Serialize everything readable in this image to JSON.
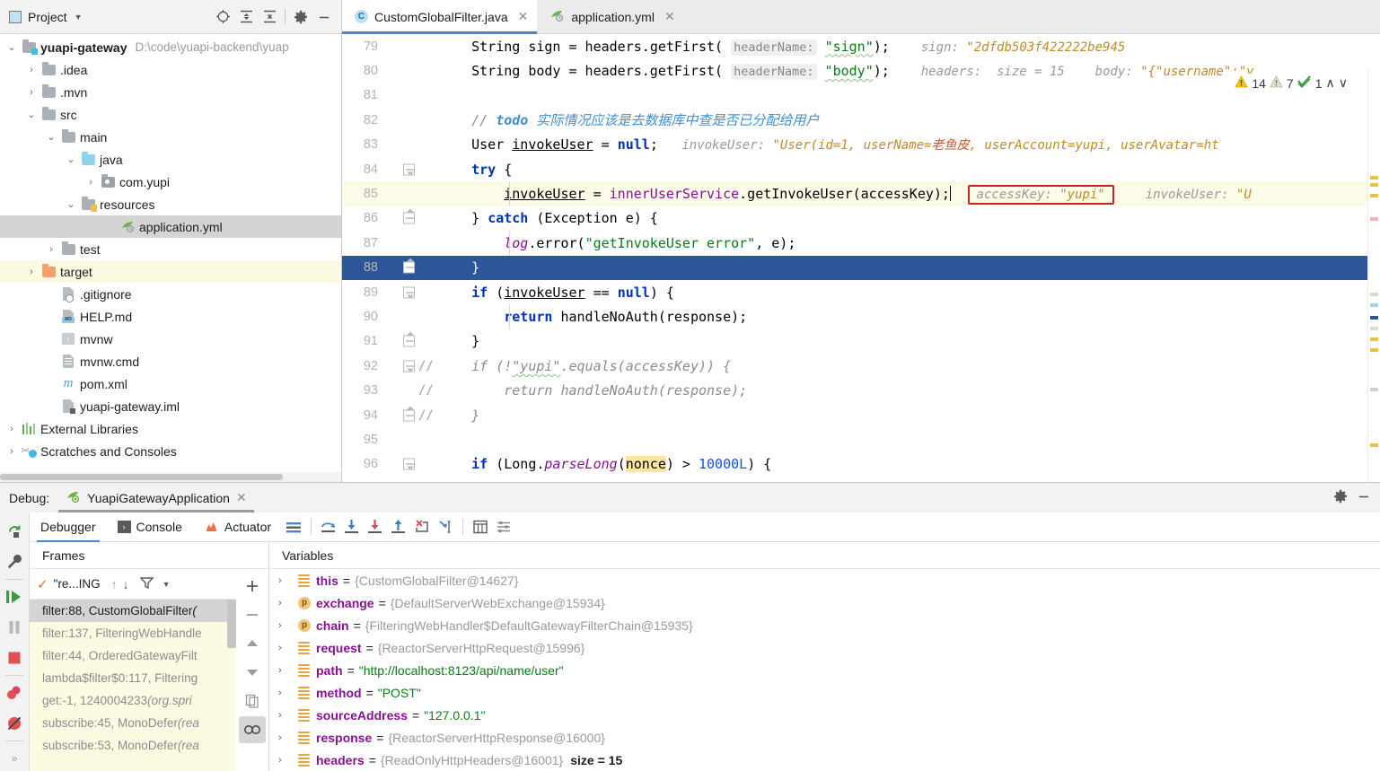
{
  "project": {
    "title": "Project",
    "header_icons": [
      "locate-icon",
      "expand-all-icon",
      "collapse-all-icon",
      "gear-icon",
      "minimize-icon"
    ],
    "tree": [
      {
        "label": "yuapi-gateway",
        "path": "D:\\code\\yuapi-backend\\yuap",
        "depth": 0,
        "twisty": "down",
        "icon": "module-folder-icon",
        "bold": true
      },
      {
        "label": ".idea",
        "path": "",
        "depth": 1,
        "twisty": "right",
        "icon": "folder-icon",
        "bold": false
      },
      {
        "label": ".mvn",
        "path": "",
        "depth": 1,
        "twisty": "right",
        "icon": "folder-icon",
        "bold": false
      },
      {
        "label": "src",
        "path": "",
        "depth": 1,
        "twisty": "down",
        "icon": "folder-icon",
        "bold": false
      },
      {
        "label": "main",
        "path": "",
        "depth": 2,
        "twisty": "down",
        "icon": "folder-icon",
        "bold": false
      },
      {
        "label": "java",
        "path": "",
        "depth": 3,
        "twisty": "down",
        "icon": "source-folder-icon",
        "bold": false
      },
      {
        "label": "com.yupi",
        "path": "",
        "depth": 4,
        "twisty": "right",
        "icon": "package-icon",
        "bold": false
      },
      {
        "label": "resources",
        "path": "",
        "depth": 3,
        "twisty": "down",
        "icon": "resources-folder-icon",
        "bold": false
      },
      {
        "label": "application.yml",
        "path": "",
        "depth": 5,
        "twisty": "none",
        "icon": "spring-yaml-icon",
        "bold": false,
        "selected": true
      },
      {
        "label": "test",
        "path": "",
        "depth": 2,
        "twisty": "right",
        "icon": "folder-icon",
        "bold": false
      },
      {
        "label": "target",
        "path": "",
        "depth": 1,
        "twisty": "right",
        "icon": "target-folder-icon",
        "bold": false,
        "highlight": true
      },
      {
        "label": ".gitignore",
        "path": "",
        "depth": 2,
        "twisty": "none",
        "icon": "gitignore-icon",
        "bold": false
      },
      {
        "label": "HELP.md",
        "path": "",
        "depth": 2,
        "twisty": "none",
        "icon": "markdown-icon",
        "bold": false
      },
      {
        "label": "mvnw",
        "path": "",
        "depth": 2,
        "twisty": "none",
        "icon": "script-icon",
        "bold": false
      },
      {
        "label": "mvnw.cmd",
        "path": "",
        "depth": 2,
        "twisty": "none",
        "icon": "text-file-icon",
        "bold": false
      },
      {
        "label": "pom.xml",
        "path": "",
        "depth": 2,
        "twisty": "none",
        "icon": "maven-icon",
        "bold": false
      },
      {
        "label": "yuapi-gateway.iml",
        "path": "",
        "depth": 2,
        "twisty": "none",
        "icon": "iml-icon",
        "bold": false
      },
      {
        "label": "External Libraries",
        "path": "",
        "depth": 0,
        "twisty": "right",
        "icon": "libraries-icon",
        "bold": false
      },
      {
        "label": "Scratches and Consoles",
        "path": "",
        "depth": 0,
        "twisty": "right",
        "icon": "scratches-icon",
        "bold": false
      }
    ]
  },
  "editor": {
    "tabs": [
      {
        "label": "CustomGlobalFilter.java",
        "icon": "java-class-icon",
        "active": true
      },
      {
        "label": "application.yml",
        "icon": "spring-yaml-icon",
        "active": false
      }
    ],
    "inspections": {
      "error_count": "14",
      "warning_count": "7",
      "ok_count": "1",
      "up_arrow": "∧",
      "down_arrow": "∨"
    },
    "lines": [
      {
        "num": "79",
        "text": "    String sign = headers.getFirst( headerName: \"sign\");   sign: \"2dfdb503f422222be945",
        "fold": "none"
      },
      {
        "num": "80",
        "text": "    String body = headers.getFirst( headerName: \"body\");   headers:  size = 15    body: \"{\"username\":\"y",
        "fold": "none"
      },
      {
        "num": "81",
        "text": "",
        "fold": "none"
      },
      {
        "num": "82",
        "text": "    // todo 实际情况应该是去数据库中查是否已分配给用户",
        "fold": "none"
      },
      {
        "num": "83",
        "text": "    User invokeUser = null;   invokeUser: \"User(id=1, userName=老鱼皮, userAccount=yupi, userAvatar=ht",
        "fold": "none"
      },
      {
        "num": "84",
        "text": "    try {",
        "fold": "down"
      },
      {
        "num": "85",
        "text": "        invokeUser = innerUserService.getInvokeUser(accessKey);   accessKey: \"yupi\"    invokeUser: \"U",
        "fold": "none"
      },
      {
        "num": "86",
        "text": "    } catch (Exception e) {",
        "fold": "up"
      },
      {
        "num": "87",
        "text": "        log.error(\"getInvokeUser error\", e);",
        "fold": "none"
      },
      {
        "num": "88",
        "text": "    }",
        "fold": "up"
      },
      {
        "num": "89",
        "text": "    if (invokeUser == null) {",
        "fold": "down"
      },
      {
        "num": "90",
        "text": "        return handleNoAuth(response);",
        "fold": "none"
      },
      {
        "num": "91",
        "text": "    }",
        "fold": "up"
      },
      {
        "num": "92",
        "text": "//    if (!\"yupi\".equals(accessKey)) {",
        "fold": "down"
      },
      {
        "num": "93",
        "text": "//        return handleNoAuth(response);",
        "fold": "none"
      },
      {
        "num": "94",
        "text": "//    }",
        "fold": "up"
      },
      {
        "num": "95",
        "text": "",
        "fold": "none"
      },
      {
        "num": "96",
        "text": "    if (Long.parseLong(nonce) > 10000L) {",
        "fold": "down"
      }
    ]
  },
  "debug": {
    "label": "Debug:",
    "config_name": "YuapiGatewayApplication",
    "tabs": [
      {
        "label": "Debugger",
        "icon": "debugger-icon",
        "active": true
      },
      {
        "label": "Console",
        "icon": "console-icon",
        "active": false
      },
      {
        "label": "Actuator",
        "icon": "actuator-icon",
        "active": false
      }
    ],
    "toolbar_icons": [
      "layout-icon",
      "step-over-icon",
      "step-into-icon",
      "force-step-into-icon",
      "step-out-icon",
      "run-to-cursor-icon",
      "drop-frame-icon",
      "evaluate-icon",
      "settings-list-icon"
    ],
    "rail_icons": [
      "rerun-icon",
      "wrench-icon",
      "resume-icon",
      "pause-icon",
      "stop-icon",
      "view-breakpoints-icon",
      "mute-breakpoints-icon"
    ],
    "right_icons": [
      "gear-icon",
      "minimize-icon",
      "layout-icon"
    ],
    "frames": {
      "header": "Frames",
      "thread_label": "\"re...ING",
      "toolbar_icons": [
        "check-icon",
        "up-icon",
        "down-icon",
        "filter-icon",
        "chevron-down-icon"
      ],
      "side_icons": [
        "add-icon",
        "remove-icon",
        "up-icon",
        "down-icon",
        "copy-icon",
        "watches-icon"
      ],
      "items": [
        {
          "label": "filter:88, CustomGlobalFilter ",
          "suffix": "(",
          "selected": true
        },
        {
          "label": "filter:137, FilteringWebHandle",
          "suffix": "",
          "selected": false
        },
        {
          "label": "filter:44, OrderedGatewayFilt",
          "suffix": "",
          "selected": false
        },
        {
          "label": "lambda$filter$0:117, Filtering",
          "suffix": "",
          "selected": false
        },
        {
          "label": "get:-1, 1240004233 ",
          "suffix": "(org.spri",
          "selected": false
        },
        {
          "label": "subscribe:45, MonoDefer ",
          "suffix": "(rea",
          "selected": false
        },
        {
          "label": "subscribe:53, MonoDefer ",
          "suffix": "(rea",
          "selected": false
        }
      ]
    },
    "variables": {
      "header": "Variables",
      "items": [
        {
          "name": "this",
          "value": "{CustomGlobalFilter@14627}",
          "kind": "obj",
          "icon": "field-stack-icon"
        },
        {
          "name": "exchange",
          "value": "{DefaultServerWebExchange@15934}",
          "kind": "obj",
          "icon": "parameter-icon"
        },
        {
          "name": "chain",
          "value": "{FilteringWebHandler$DefaultGatewayFilterChain@15935}",
          "kind": "obj",
          "icon": "parameter-icon"
        },
        {
          "name": "request",
          "value": "{ReactorServerHttpRequest@15996}",
          "kind": "obj",
          "icon": "field-stack-icon"
        },
        {
          "name": "path",
          "value": "\"http://localhost:8123/api/name/user\"",
          "kind": "str",
          "icon": "field-stack-icon"
        },
        {
          "name": "method",
          "value": "\"POST\"",
          "kind": "str",
          "icon": "field-stack-icon"
        },
        {
          "name": "sourceAddress",
          "value": "\"127.0.0.1\"",
          "kind": "str",
          "icon": "field-stack-icon"
        },
        {
          "name": "response",
          "value": "{ReactorServerHttpResponse@16000}",
          "kind": "obj",
          "icon": "field-stack-icon"
        },
        {
          "name": "headers",
          "value": "{ReadOnlyHttpHeaders@16001}",
          "kind": "obj",
          "icon": "field-stack-icon",
          "extra": "size = 15"
        }
      ]
    }
  },
  "colors": {
    "accent": "#4a86c8",
    "exec_line": "#2c5699",
    "soft_hl": "#fcfbe8",
    "selection": "#d4d4d4",
    "frames_bg": "#fbfbe3",
    "string": "#067d17",
    "keyword": "#0033b3",
    "field": "#871094",
    "box_border": "#cc2222"
  }
}
